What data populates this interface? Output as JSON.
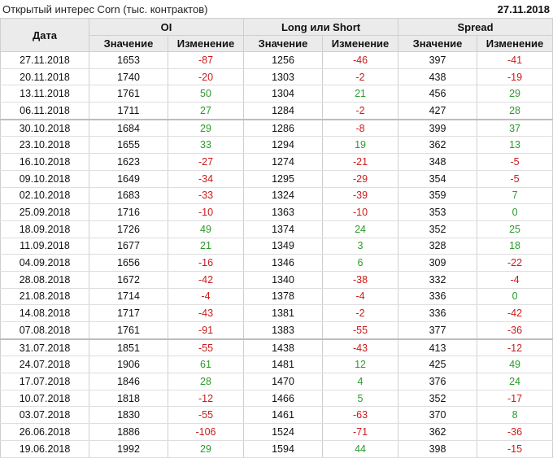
{
  "title": "Открытый интерес Corn (тыс. контрактов)",
  "date": "27.11.2018",
  "columns": {
    "date": "Дата",
    "groups": [
      "OI",
      "Long или Short",
      "Spread"
    ],
    "value": "Значение",
    "change": "Изменение"
  },
  "colors": {
    "negative": "#cc1a1a",
    "positive": "#2b9a2b"
  },
  "rows": [
    [
      "27.11.2018",
      "1653",
      "-87",
      "1256",
      "-46",
      "397",
      "-41"
    ],
    [
      "20.11.2018",
      "1740",
      "-20",
      "1303",
      "-2",
      "438",
      "-19"
    ],
    [
      "13.11.2018",
      "1761",
      "50",
      "1304",
      "21",
      "456",
      "29"
    ],
    [
      "06.11.2018",
      "1711",
      "27",
      "1284",
      "-2",
      "427",
      "28"
    ],
    [
      "30.10.2018",
      "1684",
      "29",
      "1286",
      "-8",
      "399",
      "37"
    ],
    [
      "23.10.2018",
      "1655",
      "33",
      "1294",
      "19",
      "362",
      "13"
    ],
    [
      "16.10.2018",
      "1623",
      "-27",
      "1274",
      "-21",
      "348",
      "-5"
    ],
    [
      "09.10.2018",
      "1649",
      "-34",
      "1295",
      "-29",
      "354",
      "-5"
    ],
    [
      "02.10.2018",
      "1683",
      "-33",
      "1324",
      "-39",
      "359",
      "7"
    ],
    [
      "25.09.2018",
      "1716",
      "-10",
      "1363",
      "-10",
      "353",
      "0"
    ],
    [
      "18.09.2018",
      "1726",
      "49",
      "1374",
      "24",
      "352",
      "25"
    ],
    [
      "11.09.2018",
      "1677",
      "21",
      "1349",
      "3",
      "328",
      "18"
    ],
    [
      "04.09.2018",
      "1656",
      "-16",
      "1346",
      "6",
      "309",
      "-22"
    ],
    [
      "28.08.2018",
      "1672",
      "-42",
      "1340",
      "-38",
      "332",
      "-4"
    ],
    [
      "21.08.2018",
      "1714",
      "-4",
      "1378",
      "-4",
      "336",
      "0"
    ],
    [
      "14.08.2018",
      "1717",
      "-43",
      "1381",
      "-2",
      "336",
      "-42"
    ],
    [
      "07.08.2018",
      "1761",
      "-91",
      "1383",
      "-55",
      "377",
      "-36"
    ],
    [
      "31.07.2018",
      "1851",
      "-55",
      "1438",
      "-43",
      "413",
      "-12"
    ],
    [
      "24.07.2018",
      "1906",
      "61",
      "1481",
      "12",
      "425",
      "49"
    ],
    [
      "17.07.2018",
      "1846",
      "28",
      "1470",
      "4",
      "376",
      "24"
    ],
    [
      "10.07.2018",
      "1818",
      "-12",
      "1466",
      "5",
      "352",
      "-17"
    ],
    [
      "03.07.2018",
      "1830",
      "-55",
      "1461",
      "-63",
      "370",
      "8"
    ],
    [
      "26.06.2018",
      "1886",
      "-106",
      "1524",
      "-71",
      "362",
      "-36"
    ],
    [
      "19.06.2018",
      "1992",
      "29",
      "1594",
      "44",
      "398",
      "-15"
    ]
  ]
}
